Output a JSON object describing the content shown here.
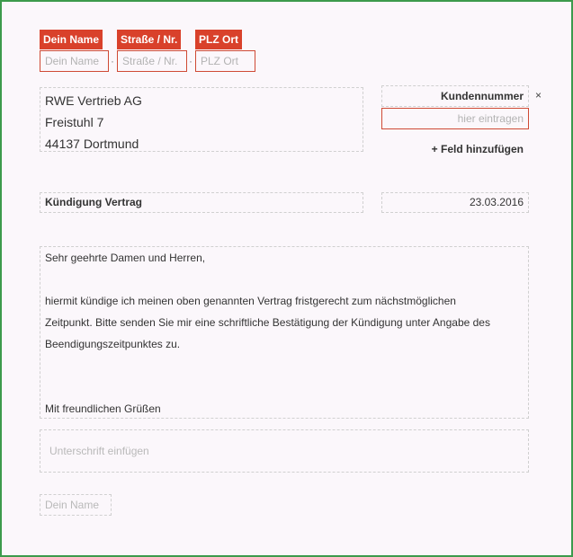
{
  "sender": {
    "tags": [
      "Dein Name",
      "Straße / Nr.",
      "PLZ Ort"
    ],
    "placeholders": [
      "Dein Name",
      "Straße / Nr.",
      "PLZ Ort"
    ],
    "separator": "·"
  },
  "recipient": {
    "lines": [
      "RWE Vertrieb AG",
      "Freistuhl 7",
      "44137 Dortmund"
    ]
  },
  "customer_number": {
    "label": "Kundennummer",
    "remove_glyph": "×",
    "placeholder": "hier eintragen",
    "add_field_label": "+ Feld hinzufügen"
  },
  "subject": {
    "text": "Kündigung Vertrag",
    "date": "23.03.2016"
  },
  "letter_body": {
    "salutation": "Sehr geehrte Damen und Herren,",
    "paragraph": [
      "hiermit kündige ich meinen oben genannten Vertrag fristgerecht zum nächstmöglichen",
      "Zeitpunkt. Bitte senden Sie mir eine schriftliche Bestätigung der Kündigung unter Angabe des",
      "Beendigungszeitpunktes zu."
    ],
    "closing": "Mit freundlichen Grüßen"
  },
  "signature": {
    "placeholder": "Unterschrift einfügen"
  },
  "footer_name": {
    "placeholder": "Dein Name"
  },
  "colors": {
    "accent": "#d9412b",
    "frame": "#3c9a4c",
    "background": "#fbf7fb"
  }
}
